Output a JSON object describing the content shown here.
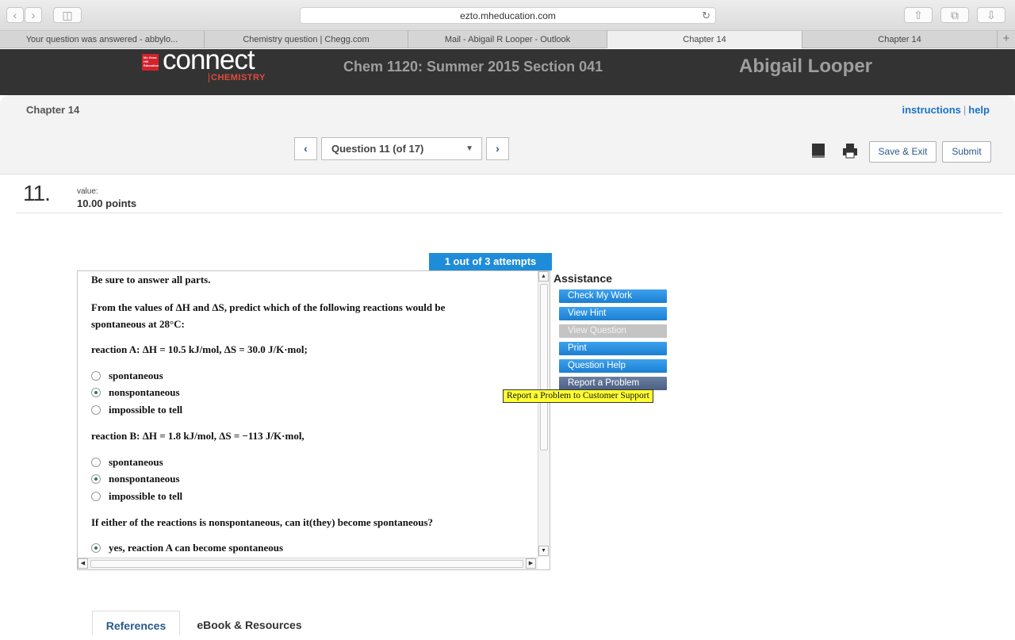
{
  "browser": {
    "url": "ezto.mheducation.com",
    "tabs": [
      {
        "label": "Your question was answered - abbylo..."
      },
      {
        "label": "Chemistry question | Chegg.com"
      },
      {
        "label": "Mail - Abigail R Looper - Outlook"
      },
      {
        "label": "Chapter 14"
      },
      {
        "label": "Chapter 14"
      }
    ]
  },
  "header": {
    "logo_box_text": "Mc Graw Hill Education",
    "logo_main": "connect",
    "logo_sub": "CHEMISTRY",
    "course": "Chem 1120: Summer 2015 Section 041",
    "user": "Abigail Looper"
  },
  "toolbar": {
    "chapter": "Chapter 14",
    "instructions": "instructions",
    "help": "help",
    "separator": "|",
    "question_select": "Question 11 (of 17)",
    "save_exit": "Save & Exit",
    "submit": "Submit"
  },
  "question": {
    "number": "11.",
    "value_label": "value:",
    "points": "10.00 points",
    "attempts": "1 out of 3 attempts",
    "intro": "Be sure to answer all parts.",
    "prompt_line1": "From the values of ΔH and ΔS, predict which of the following reactions would be",
    "prompt_line2": "spontaneous at 28°C:",
    "reaction_a": "reaction A: ΔH = 10.5 kJ/mol, ΔS = 30.0 J/K·mol;",
    "reaction_b": "reaction B: ΔH = 1.8 kJ/mol, ΔS = −113 J/K·mol,",
    "options_a": [
      "spontaneous",
      "nonspontaneous",
      "impossible to tell"
    ],
    "options_b": [
      "spontaneous",
      "nonspontaneous",
      "impossible to tell"
    ],
    "followup": "If either of the reactions is nonspontaneous, can it(they) become spontaneous?",
    "followup_answer": "yes, reaction A can become spontaneous"
  },
  "assistance": {
    "title": "Assistance",
    "check_work": "Check My Work",
    "view_hint": "View Hint",
    "view_question": "View Question",
    "print": "Print",
    "question_help": "Question Help",
    "report_problem": "Report a Problem",
    "tooltip": "Report a Problem to Customer Support"
  },
  "bottom_tabs": {
    "references": "References",
    "ebook": "eBook & Resources"
  },
  "colors": {
    "accent_blue": "#1f8cd9",
    "header_bg": "#333333",
    "tooltip_yellow": "#ffff33"
  }
}
